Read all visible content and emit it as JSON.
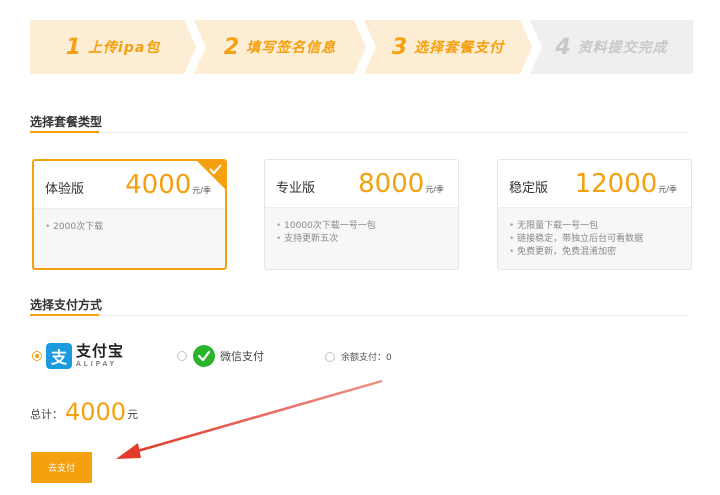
{
  "steps": [
    {
      "num": "1",
      "label": "上传ipa包",
      "state": "active"
    },
    {
      "num": "2",
      "label": "填写签名信息",
      "state": "active"
    },
    {
      "num": "3",
      "label": "选择套餐支付",
      "state": "active"
    },
    {
      "num": "4",
      "label": "资料提交完成",
      "state": "inactive"
    }
  ],
  "plan_section": {
    "title": "选择套餐类型"
  },
  "plans": [
    {
      "name": "体验版",
      "price": "4000",
      "unit": "元/季",
      "selected": true,
      "features": [
        "2000次下载"
      ]
    },
    {
      "name": "专业版",
      "price": "8000",
      "unit": "元/季",
      "selected": false,
      "features": [
        "10000次下载一号一包",
        "支持更新五次"
      ]
    },
    {
      "name": "稳定版",
      "price": "12000",
      "unit": "元/季",
      "selected": false,
      "features": [
        "无限量下载一号一包",
        "链接稳定，带独立后台可看数据",
        "免费更新，免费混淆加密"
      ]
    }
  ],
  "payment_section": {
    "title": "选择支付方式"
  },
  "payment": {
    "alipay": {
      "cn": "支付宝",
      "en": "ALIPAY",
      "logo_glyph": "支",
      "selected": true
    },
    "wechat": {
      "label": "微信支付",
      "selected": false
    },
    "balance": {
      "label": "余额支付：0",
      "selected": false
    }
  },
  "total": {
    "label": "总计",
    "colon": "：",
    "amount": "4000",
    "unit": "元"
  },
  "pay_button": {
    "label": "去支付"
  },
  "colors": {
    "accent": "#f5a00e",
    "step_active_bg": "#fdedd4",
    "step_inactive_bg": "#efefef",
    "alipay": "#1a9be0",
    "wechat": "#2bb32b",
    "annotation": "#e33a2a"
  }
}
